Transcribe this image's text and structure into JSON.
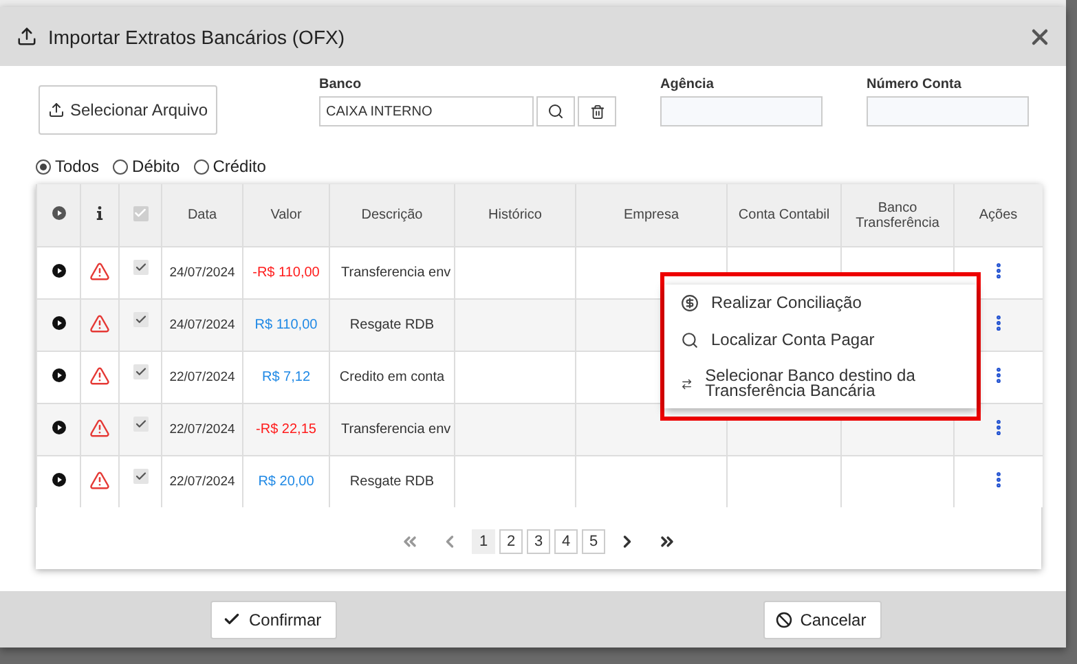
{
  "window": {
    "title": "Importar Extratos Bancários (OFX)"
  },
  "file_button": "Selecionar Arquivo",
  "fields": [
    {
      "label": "Banco",
      "value": "CAIXA INTERNO",
      "kind": "lookup"
    },
    {
      "label": "Agência",
      "kind": "text"
    },
    {
      "label": "Número Conta",
      "kind": "text"
    }
  ],
  "filters": [
    {
      "label": "Todos",
      "selected": true
    },
    {
      "label": "Débito",
      "selected": false
    },
    {
      "label": "Crédito",
      "selected": false
    }
  ],
  "table": {
    "select_all_checked": true,
    "columns": [
      "Data",
      "Valor",
      "Descrição",
      "Histórico",
      "Empresa",
      "Conta Contabil",
      "Banco Transferência",
      "Ações"
    ],
    "rows": [
      {
        "date": "24/07/2024",
        "value": "-R$ 110,00",
        "kind": "debit",
        "description": "Transferencia env",
        "checked": true
      },
      {
        "date": "24/07/2024",
        "value": "R$ 110,00",
        "kind": "credit",
        "description": "Resgate RDB",
        "checked": true
      },
      {
        "date": "22/07/2024",
        "value": "R$ 7,12",
        "kind": "credit",
        "description": "Credito em conta",
        "checked": true
      },
      {
        "date": "22/07/2024",
        "value": "-R$ 22,15",
        "kind": "debit",
        "description": "Transferencia env",
        "checked": true
      },
      {
        "date": "22/07/2024",
        "value": "R$ 20,00",
        "kind": "credit",
        "description": "Resgate RDB",
        "checked": true
      }
    ]
  },
  "context_menu": [
    {
      "label": "Realizar Conciliação",
      "kind": "reconcile"
    },
    {
      "label": "Localizar Conta Pagar",
      "kind": "search"
    },
    {
      "label": "Selecionar Banco destino da Transferência Bancária",
      "kind": "transfer"
    }
  ],
  "pagination": [
    {
      "label": "1",
      "selected": true
    },
    {
      "label": "2",
      "selected": false
    },
    {
      "label": "3",
      "selected": false
    },
    {
      "label": "4",
      "selected": false
    },
    {
      "label": "5",
      "selected": false
    }
  ],
  "buttons": [
    {
      "label": "Confirmar",
      "kind": "confirm"
    },
    {
      "label": "Cancelar",
      "kind": "cancel"
    }
  ]
}
